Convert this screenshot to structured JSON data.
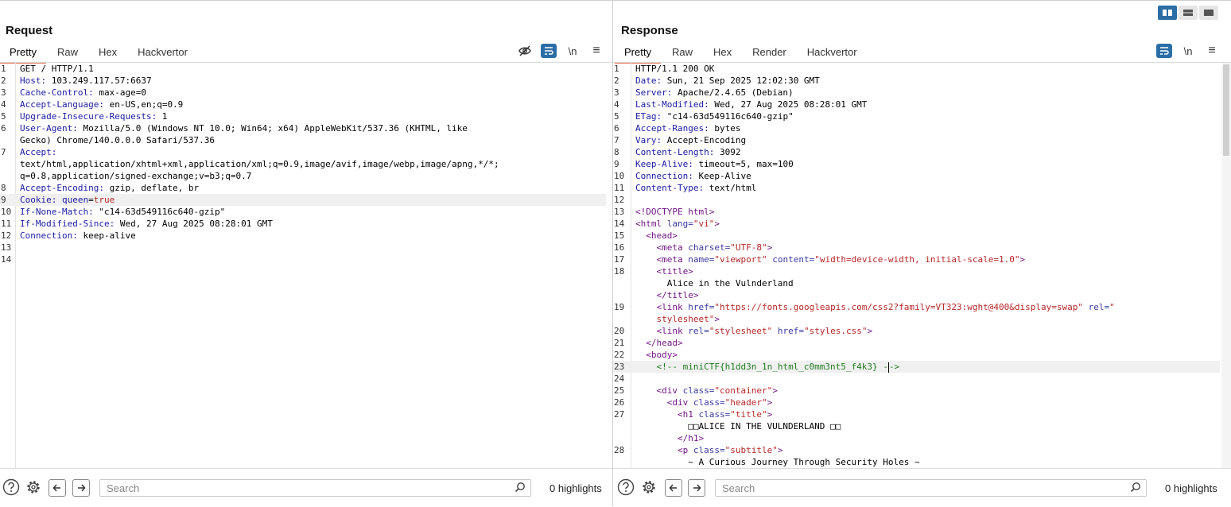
{
  "layout_toggle": {
    "icons": [
      "columns-icon",
      "rows-icon",
      "single-pane-icon"
    ]
  },
  "request": {
    "title": "Request",
    "tabs": [
      "Pretty",
      "Raw",
      "Hex",
      "Hackvertor"
    ],
    "active_tab": "Pretty",
    "tools": {
      "hide": "eye-slash-icon",
      "wrap": "wrap-icon",
      "newline": "\\n",
      "menu": "≡"
    },
    "lines": [
      {
        "n": "1",
        "text": "GET / HTTP/1.1"
      },
      {
        "n": "2",
        "name": "Host:",
        "value": " 103.249.117.57:6637"
      },
      {
        "n": "3",
        "name": "Cache-Control:",
        "value": " max-age=0"
      },
      {
        "n": "4",
        "name": "Accept-Language:",
        "value": " en-US,en;q=0.9"
      },
      {
        "n": "5",
        "name": "Upgrade-Insecure-Requests:",
        "value": " 1"
      },
      {
        "n": "6",
        "name": "User-Agent:",
        "value": " Mozilla/5.0 (Windows NT 10.0; Win64; x64) AppleWebKit/537.36 (KHTML, like"
      },
      {
        "n": "",
        "text": "Gecko) Chrome/140.0.0.0 Safari/537.36"
      },
      {
        "n": "7",
        "name": "Accept:",
        "value": ""
      },
      {
        "n": "",
        "text": "text/html,application/xhtml+xml,application/xml;q=0.9,image/avif,image/webp,image/apng,*/*;"
      },
      {
        "n": "",
        "text": "q=0.8,application/signed-exchange;v=b3;q=0.7"
      },
      {
        "n": "8",
        "name": "Accept-Encoding:",
        "value": " gzip, deflate, br"
      },
      {
        "n": "9",
        "name": "Cookie:",
        "cookie_name": " queen",
        "cookie_eq": "=",
        "cookie_val": "true",
        "highlight": true
      },
      {
        "n": "10",
        "name": "If-None-Match:",
        "value": " \"c14-63d549116c640-gzip\""
      },
      {
        "n": "11",
        "name": "If-Modified-Since:",
        "value": " Wed, 27 Aug 2025 08:28:01 GMT"
      },
      {
        "n": "12",
        "name": "Connection:",
        "value": " keep-alive"
      },
      {
        "n": "13",
        "text": ""
      },
      {
        "n": "14",
        "text": ""
      }
    ],
    "search_placeholder": "Search",
    "highlights": "0 highlights"
  },
  "response": {
    "title": "Response",
    "tabs": [
      "Pretty",
      "Raw",
      "Hex",
      "Render",
      "Hackvertor"
    ],
    "active_tab": "Pretty",
    "tools": {
      "wrap": "wrap-icon",
      "newline": "\\n",
      "menu": "≡"
    },
    "lines": [
      {
        "n": "1",
        "text": "HTTP/1.1 200 OK"
      },
      {
        "n": "2",
        "name": "Date:",
        "value": " Sun, 21 Sep 2025 12:02:30 GMT"
      },
      {
        "n": "3",
        "name": "Server:",
        "value": " Apache/2.4.65 (Debian)"
      },
      {
        "n": "4",
        "name": "Last-Modified:",
        "value": " Wed, 27 Aug 2025 08:28:01 GMT"
      },
      {
        "n": "5",
        "name": "ETag:",
        "value": " \"c14-63d549116c640-gzip\""
      },
      {
        "n": "6",
        "name": "Accept-Ranges:",
        "value": " bytes"
      },
      {
        "n": "7",
        "name": "Vary:",
        "value": " Accept-Encoding"
      },
      {
        "n": "8",
        "name": "Content-Length:",
        "value": " 3092"
      },
      {
        "n": "9",
        "name": "Keep-Alive:",
        "value": " timeout=5, max=100"
      },
      {
        "n": "10",
        "name": "Connection:",
        "value": " Keep-Alive"
      },
      {
        "n": "11",
        "name": "Content-Type:",
        "value": " text/html"
      },
      {
        "n": "12",
        "text": ""
      },
      {
        "n": "13",
        "html": "<span class=\"tag\">&lt;!DOCTYPE html&gt;</span>"
      },
      {
        "n": "14",
        "html": "<span class=\"tag\">&lt;html</span> <span class=\"attr\">lang=</span><span class=\"val\">\"vi\"</span><span class=\"tag\">&gt;</span>"
      },
      {
        "n": "15",
        "html": "  <span class=\"tag\">&lt;head&gt;</span>"
      },
      {
        "n": "16",
        "html": "    <span class=\"tag\">&lt;meta</span> <span class=\"attr\">charset=</span><span class=\"val\">\"UTF-8\"</span><span class=\"tag\">&gt;</span>"
      },
      {
        "n": "17",
        "html": "    <span class=\"tag\">&lt;meta</span> <span class=\"attr\">name=</span><span class=\"val\">\"viewport\"</span> <span class=\"attr\">content=</span><span class=\"val\">\"width=device-width, initial-scale=1.0\"</span><span class=\"tag\">&gt;</span>"
      },
      {
        "n": "18",
        "html": "    <span class=\"tag\">&lt;title&gt;</span>"
      },
      {
        "n": "",
        "html": "      Alice in the Vulnderland"
      },
      {
        "n": "",
        "html": "    <span class=\"tag\">&lt;/title&gt;</span>"
      },
      {
        "n": "19",
        "html": "    <span class=\"tag\">&lt;link</span> <span class=\"attr\">href=</span><span class=\"val\">\"https://fonts.googleapis.com/css2?family=VT323:wght@400&amp;display=swap\"</span> <span class=\"attr\">rel=</span><span class=\"val\">\"</span>"
      },
      {
        "n": "",
        "html": "    <span class=\"val\">stylesheet\"</span><span class=\"tag\">&gt;</span>"
      },
      {
        "n": "20",
        "html": "    <span class=\"tag\">&lt;link</span> <span class=\"attr\">rel=</span><span class=\"val\">\"stylesheet\"</span> <span class=\"attr\">href=</span><span class=\"val\">\"styles.css\"</span><span class=\"tag\">&gt;</span>"
      },
      {
        "n": "21",
        "html": "  <span class=\"tag\">&lt;/head&gt;</span>"
      },
      {
        "n": "22",
        "html": "  <span class=\"tag\">&lt;body&gt;</span>"
      },
      {
        "n": "23",
        "html": "    <span class=\"cmt\">&lt;!-- miniCTF{h1dd3n_1n_html_c0mm3nt5_f4k3} -</span><span class=\"cursor\"></span><span class=\"cmt\">-&gt;</span>",
        "highlight": true
      },
      {
        "n": "24",
        "html": ""
      },
      {
        "n": "25",
        "html": "    <span class=\"tag\">&lt;div</span> <span class=\"attr\">class=</span><span class=\"val\">\"container\"</span><span class=\"tag\">&gt;</span>"
      },
      {
        "n": "26",
        "html": "      <span class=\"tag\">&lt;div</span> <span class=\"attr\">class=</span><span class=\"val\">\"header\"</span><span class=\"tag\">&gt;</span>"
      },
      {
        "n": "27",
        "html": "        <span class=\"tag\">&lt;h1</span> <span class=\"attr\">class=</span><span class=\"val\">\"title\"</span><span class=\"tag\">&gt;</span>"
      },
      {
        "n": "",
        "html": "          □□ALICE IN THE VULNDERLAND □□"
      },
      {
        "n": "",
        "html": "        <span class=\"tag\">&lt;/h1&gt;</span>"
      },
      {
        "n": "28",
        "html": "        <span class=\"tag\">&lt;p</span> <span class=\"attr\">class=</span><span class=\"val\">\"subtitle\"</span><span class=\"tag\">&gt;</span>"
      },
      {
        "n": "",
        "html": "          ~ A Curious Journey Through Security Holes ~"
      }
    ],
    "search_placeholder": "Search",
    "highlights": "0 highlights"
  }
}
